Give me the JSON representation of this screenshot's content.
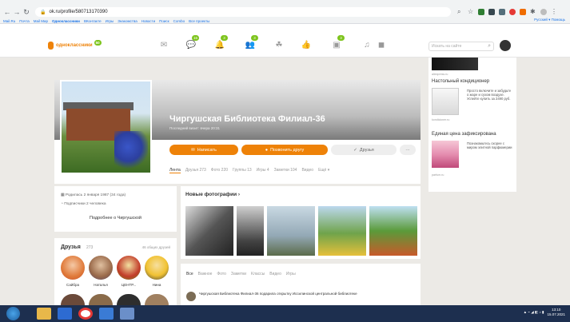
{
  "browser": {
    "url": "ok.ru/profile/580713170390",
    "bookmarks": [
      "Mail.Ru",
      "Почта",
      "Mail Мир",
      "Одноклассники",
      "ВКонтакте",
      "Игры",
      "Знакомства",
      "Новости",
      "Поиск",
      "Combo",
      "Все проекты"
    ],
    "bookmarks_right": "Русский ▾  Помощь"
  },
  "header": {
    "logo": "одноклассники",
    "logo_badge": "50",
    "badges": [
      "16",
      "3",
      "3",
      "3"
    ],
    "search_placeholder": "Искать на сайте"
  },
  "profile": {
    "name": "Чиргушская Библиотека Филиал-36",
    "last_visit": "Последний визит: вчера 20:31",
    "btn_write": "Написать",
    "btn_invite": "Позвонить другу",
    "btn_friends": "Друзья",
    "btn_more": "···",
    "tabs": [
      "Лента",
      "Друзья 273",
      "Фото 220",
      "Группы 13",
      "Игры 4",
      "Заметки 104",
      "Видео",
      "Ещё ▾"
    ]
  },
  "info": {
    "born": "Родилась 2 января 1987 (34 года)",
    "subscribers": "Подписчики 2 человека",
    "more": "Подробнее о Чиргушской"
  },
  "friends": {
    "title": "Друзья",
    "count": "273",
    "common": "46 общих друзей",
    "names": [
      "Сайбра",
      "Наталья",
      "ЦЕНТР...",
      "Нина"
    ]
  },
  "photos": {
    "title": "Новые фотографии"
  },
  "feed": {
    "tabs": [
      "Все",
      "Важное",
      "Фото",
      "Заметки",
      "Классы",
      "Видео",
      "Игры"
    ],
    "item": "Чиргушская Библиотека Филиал-36 подарила открытку Иссилинской центральной библиотеке"
  },
  "ads": [
    {
      "title": "",
      "text": "",
      "source": "aliexpress.ru"
    },
    {
      "title": "Настольный кондиционер",
      "text": "Просто включите и забудьте о жаре и сухом воздухе. Успейте купить за 2490 руб.",
      "source": "kondicioner.ru"
    },
    {
      "title": "Единая цена зафиксирована",
      "text": "Познакомьтесь скорее с миром элитной парфюмерии",
      "source": "parfum.ru"
    }
  ],
  "taskbar": {
    "time": "13:10",
    "date": "15.07.2021"
  },
  "colors": {
    "ok_orange": "#ee8208",
    "ok_green": "#7dc41c",
    "taskbar": "#1d2f4f"
  }
}
